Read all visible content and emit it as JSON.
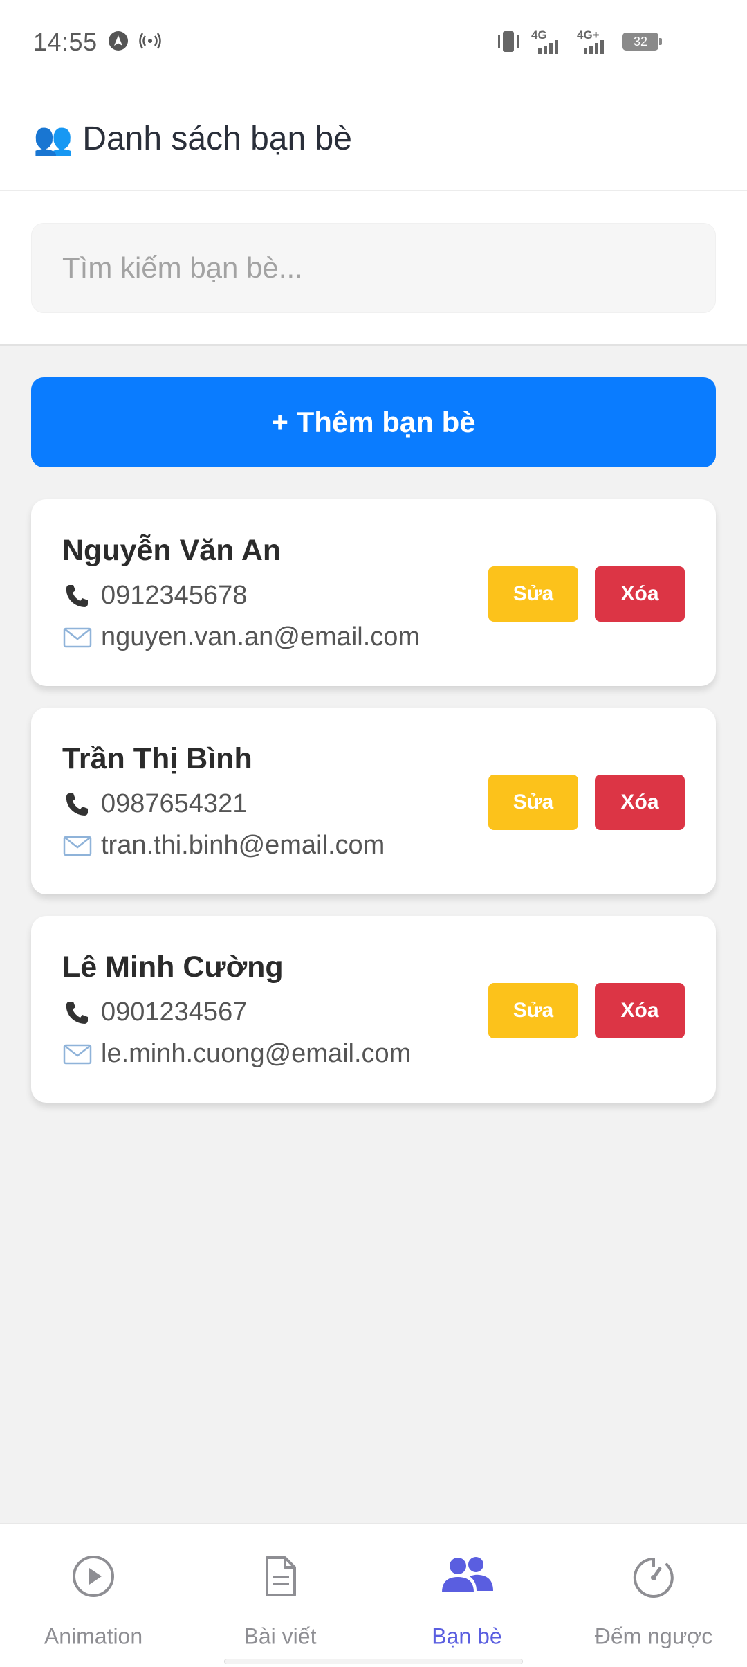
{
  "status_bar": {
    "time": "14:55",
    "network1": "4G",
    "network2": "4G+",
    "battery": "32"
  },
  "header": {
    "icon": "👥",
    "title": "Danh sách bạn bè"
  },
  "search": {
    "placeholder": "Tìm kiếm bạn bè..."
  },
  "add_button_label": "+ Thêm bạn bè",
  "friends": [
    {
      "name": "Nguyễn Văn An",
      "phone": "0912345678",
      "email": "nguyen.van.an@email.com",
      "edit_label": "Sửa",
      "delete_label": "Xóa"
    },
    {
      "name": "Trần Thị Bình",
      "phone": "0987654321",
      "email": "tran.thi.binh@email.com",
      "edit_label": "Sửa",
      "delete_label": "Xóa"
    },
    {
      "name": "Lê Minh Cường",
      "phone": "0901234567",
      "email": "le.minh.cuong@email.com",
      "edit_label": "Sửa",
      "delete_label": "Xóa"
    }
  ],
  "bottom_nav": [
    {
      "label": "Animation",
      "icon": "play-circle-icon",
      "active": false
    },
    {
      "label": "Bài viết",
      "icon": "document-icon",
      "active": false
    },
    {
      "label": "Bạn bè",
      "icon": "people-icon",
      "active": true
    },
    {
      "label": "Đếm ngược",
      "icon": "timer-icon",
      "active": false
    }
  ],
  "colors": {
    "primary": "#0a7cff",
    "edit": "#fcc21b",
    "delete": "#dc3545",
    "nav_active": "#5a5ee0",
    "nav_inactive": "#8e8e93"
  }
}
